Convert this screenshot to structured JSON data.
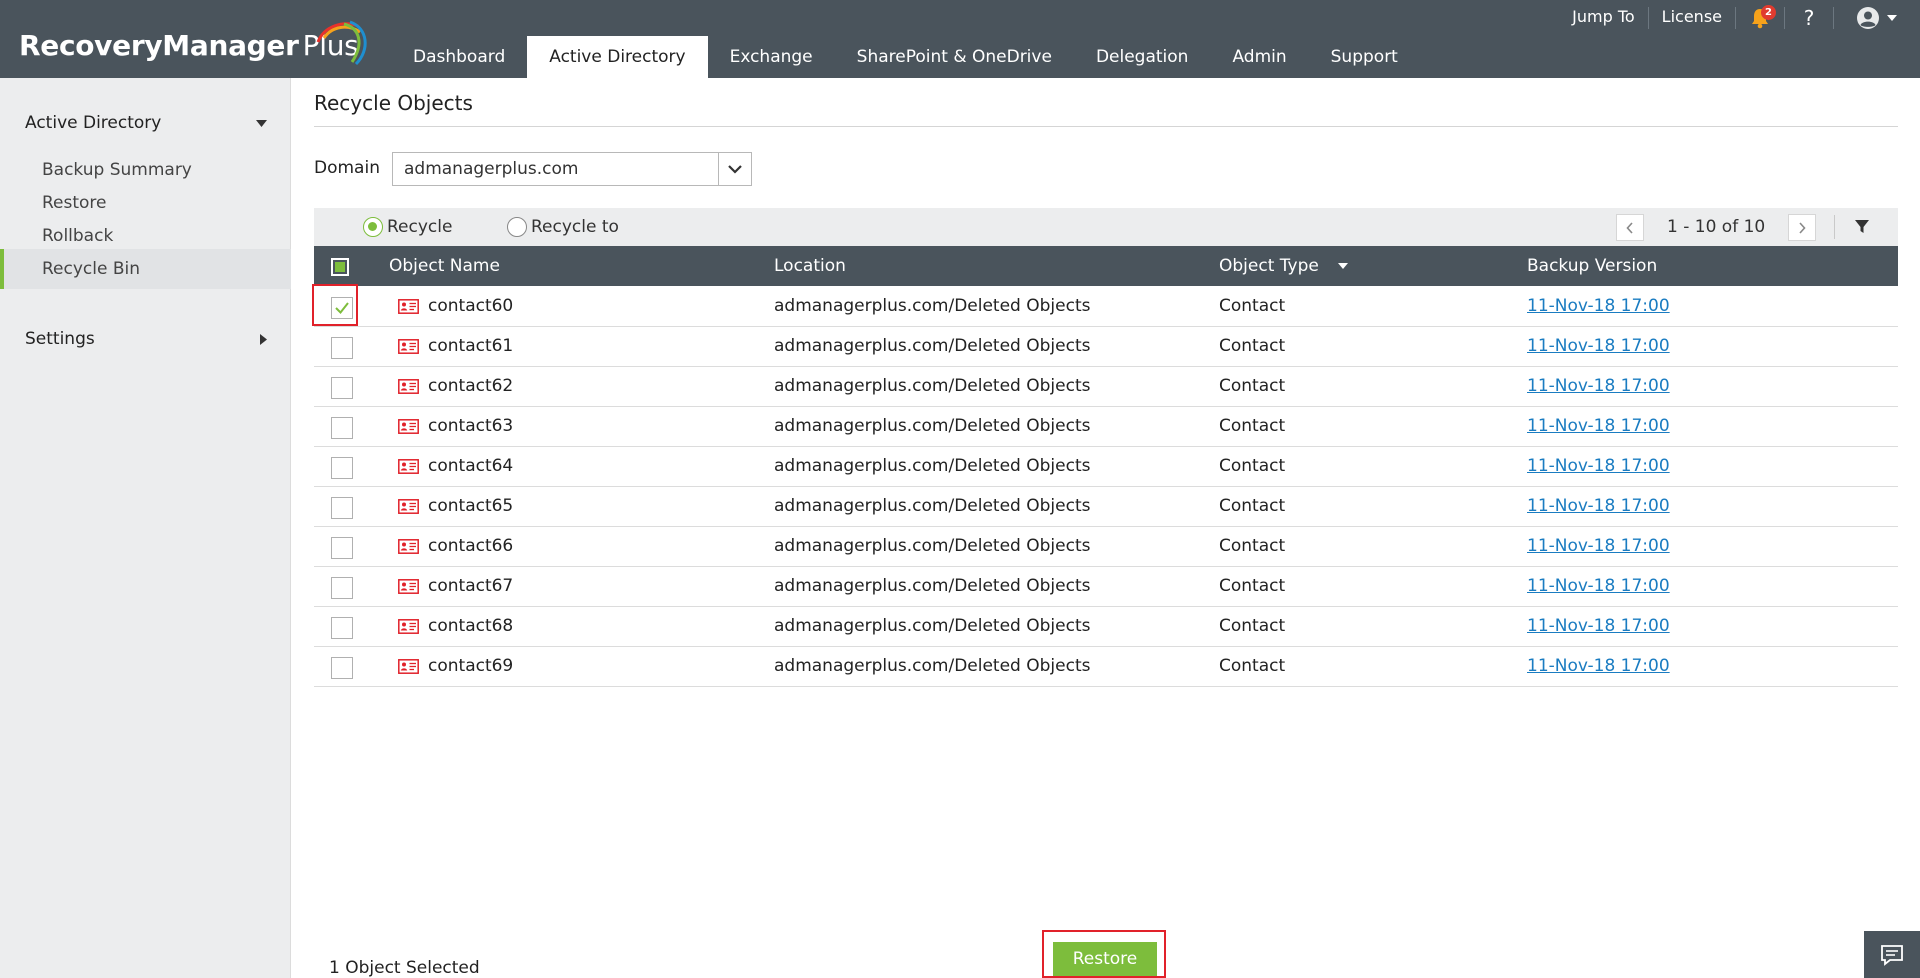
{
  "app": {
    "logo_main": "RecoveryManager",
    "logo_plus": "Plus",
    "logo_colors": [
      "#e8322b",
      "#f6a21b",
      "#7dbd3c",
      "#1f8fd0"
    ]
  },
  "colors": {
    "header_bg": "#4a545c",
    "accent_green": "#7dbd3c",
    "link_blue": "#1a7cc1",
    "highlight_red": "#e1212a",
    "badge_red": "#e03b2f"
  },
  "nav": {
    "tabs": [
      {
        "label": "Dashboard"
      },
      {
        "label": "Active Directory",
        "active": true
      },
      {
        "label": "Exchange"
      },
      {
        "label": "SharePoint & OneDrive"
      },
      {
        "label": "Delegation"
      },
      {
        "label": "Admin"
      },
      {
        "label": "Support"
      }
    ]
  },
  "topright": {
    "jump_to": "Jump To",
    "license": "License",
    "bell_icon": "bell-icon",
    "bell_count": "2",
    "help_icon": "help-icon",
    "help_symbol": "?",
    "user_icon": "user-avatar-icon"
  },
  "sidebar": {
    "group_ad": "Active Directory",
    "items": [
      {
        "label": "Backup Summary"
      },
      {
        "label": "Restore"
      },
      {
        "label": "Rollback"
      },
      {
        "label": "Recycle Bin",
        "active": true
      }
    ],
    "group_settings": "Settings"
  },
  "main": {
    "title": "Recycle Objects",
    "domain_label": "Domain",
    "domain_value": "admanagerplus.com",
    "radio_recycle": "Recycle",
    "radio_recycle_to": "Recycle to",
    "selected_radio": "Recycle",
    "pagination": "1 - 10 of 10",
    "columns": {
      "name": "Object Name",
      "location": "Location",
      "type": "Object Type",
      "version": "Backup Version"
    },
    "sort_column": "Object Type",
    "rows": [
      {
        "name": "contact60",
        "location": "admanagerplus.com/Deleted Objects",
        "type": "Contact",
        "version": "11-Nov-18 17:00",
        "checked": true
      },
      {
        "name": "contact61",
        "location": "admanagerplus.com/Deleted Objects",
        "type": "Contact",
        "version": "11-Nov-18 17:00",
        "checked": false
      },
      {
        "name": "contact62",
        "location": "admanagerplus.com/Deleted Objects",
        "type": "Contact",
        "version": "11-Nov-18 17:00",
        "checked": false
      },
      {
        "name": "contact63",
        "location": "admanagerplus.com/Deleted Objects",
        "type": "Contact",
        "version": "11-Nov-18 17:00",
        "checked": false
      },
      {
        "name": "contact64",
        "location": "admanagerplus.com/Deleted Objects",
        "type": "Contact",
        "version": "11-Nov-18 17:00",
        "checked": false
      },
      {
        "name": "contact65",
        "location": "admanagerplus.com/Deleted Objects",
        "type": "Contact",
        "version": "11-Nov-18 17:00",
        "checked": false
      },
      {
        "name": "contact66",
        "location": "admanagerplus.com/Deleted Objects",
        "type": "Contact",
        "version": "11-Nov-18 17:00",
        "checked": false
      },
      {
        "name": "contact67",
        "location": "admanagerplus.com/Deleted Objects",
        "type": "Contact",
        "version": "11-Nov-18 17:00",
        "checked": false
      },
      {
        "name": "contact68",
        "location": "admanagerplus.com/Deleted Objects",
        "type": "Contact",
        "version": "11-Nov-18 17:00",
        "checked": false
      },
      {
        "name": "contact69",
        "location": "admanagerplus.com/Deleted Objects",
        "type": "Contact",
        "version": "11-Nov-18 17:00",
        "checked": false
      }
    ],
    "row_icon": "contact-card-icon",
    "selected_count": "1 Object Selected",
    "restore_label": "Restore",
    "chat_icon": "chat-icon"
  }
}
